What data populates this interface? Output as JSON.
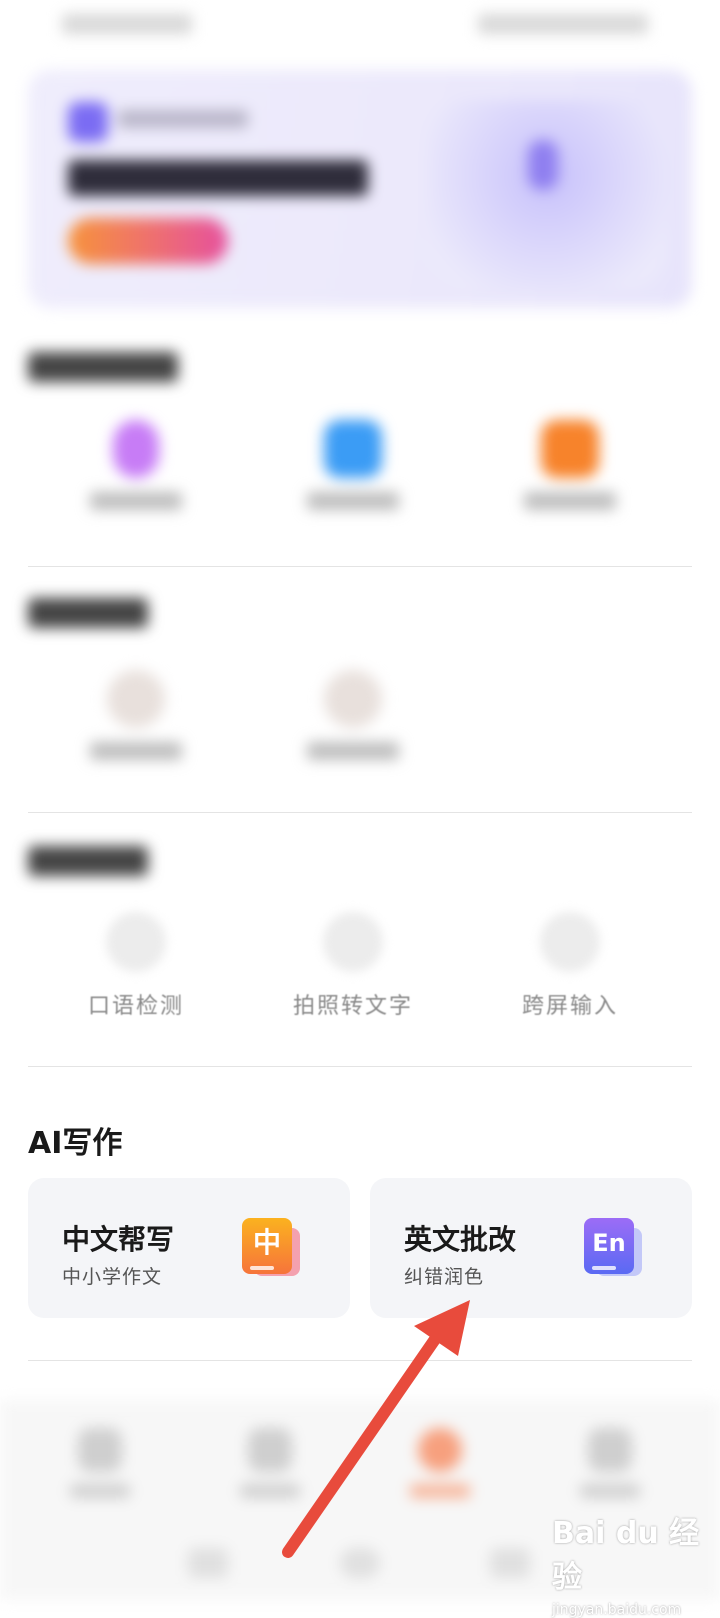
{
  "section3": {
    "items": [
      {
        "label": "口语检测",
        "icon": "mic-check-icon"
      },
      {
        "label": "拍照转文字",
        "icon": "camera-ocr-icon"
      },
      {
        "label": "跨屏输入",
        "icon": "cross-screen-icon"
      }
    ]
  },
  "ai_writing": {
    "title": "AI写作",
    "cards": [
      {
        "title": "中文帮写",
        "subtitle": "中小学作文",
        "badge": "中",
        "icon": "chinese-writing-icon",
        "color_a": "#f9a51b",
        "color_b": "#f45b73"
      },
      {
        "title": "英文批改",
        "subtitle": "纠错润色",
        "badge": "En",
        "icon": "english-correction-icon",
        "color_a": "#8a6cf5",
        "color_b": "#5b6cf3"
      }
    ]
  },
  "watermark": {
    "brand": "Bai du 经验",
    "url": "jingyan.baidu.com"
  },
  "colors": {
    "accent_orange": "#f37a4c",
    "arrow_red": "#e84b3c"
  }
}
